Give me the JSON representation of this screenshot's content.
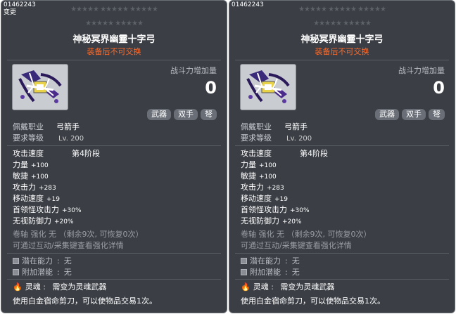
{
  "tooltips": [
    {
      "header_id": "01462243",
      "header_sub": "变更",
      "stars_row1": "★★★★★ ★★★★★ ★★★★★",
      "stars_row2": "★★★★★ ★★★★★",
      "item_name": "神秘冥界幽靈十字弓",
      "trade_note": "装备后不可交换",
      "combat_power_label": "战斗力增加量",
      "combat_power_value": "0",
      "tags": [
        "武器",
        "双手",
        "弩"
      ],
      "req_job_label": "佩戴职业",
      "req_job_value": "弓箭手",
      "req_level_label": "要求等级",
      "req_level_value": "Lv. 200",
      "attack_speed_label": "攻击速度",
      "attack_speed_value": "第4阶段",
      "stats": [
        {
          "label": "力量",
          "value": "+100"
        },
        {
          "label": "敏捷",
          "value": "+100"
        },
        {
          "label": "攻击力",
          "value": "+283"
        },
        {
          "label": "移动速度",
          "value": "+19"
        },
        {
          "label": "首领怪攻击力",
          "value": "+30%"
        },
        {
          "label": "无视防御力",
          "value": "+20%"
        }
      ],
      "scroll_line": "卷轴 强化 无 （剩余9次, 可恢复0次）",
      "enhance_line": "可通过互动/采集键查看强化详情",
      "potential_label": "潜在能力",
      "potential_value": "无",
      "bonus_potential_label": "附加潜能",
      "bonus_potential_value": "无",
      "soul_label": "灵魂",
      "soul_value": "需变为灵魂武器",
      "footer": "使用白金宿命剪刀，可以使物品交易1次。"
    },
    {
      "header_id": "01462243",
      "header_sub": "",
      "stars_row1": "★★★★★ ★★★★★ ★★★★★",
      "stars_row2": "★★★★★ ★★★★★",
      "item_name": "神秘冥界幽靈十字弓",
      "trade_note": "装备后不可交换",
      "combat_power_label": "战斗力增加量",
      "combat_power_value": "0",
      "tags": [
        "武器",
        "双手",
        "弩"
      ],
      "req_job_label": "佩戴职业",
      "req_job_value": "弓箭手",
      "req_level_label": "要求等级",
      "req_level_value": "Lv. 200",
      "attack_speed_label": "攻击速度",
      "attack_speed_value": "第4阶段",
      "stats": [
        {
          "label": "力量",
          "value": "+100"
        },
        {
          "label": "敏捷",
          "value": "+100"
        },
        {
          "label": "攻击力",
          "value": "+283"
        },
        {
          "label": "移动速度",
          "value": "+19"
        },
        {
          "label": "首领怪攻击力",
          "value": "+30%"
        },
        {
          "label": "无视防御力",
          "value": "+20%"
        }
      ],
      "scroll_line": "卷轴 强化 无 （剩余9次, 可恢复0次）",
      "enhance_line": "可通过互动/采集键查看强化详情",
      "potential_label": "潜在能力",
      "potential_value": "无",
      "bonus_potential_label": "附加潜能",
      "bonus_potential_value": "无",
      "soul_label": "灵魂",
      "soul_value": "需变为灵魂武器",
      "footer": "使用白金宿命剪刀，可以使物品交易1次。"
    }
  ]
}
